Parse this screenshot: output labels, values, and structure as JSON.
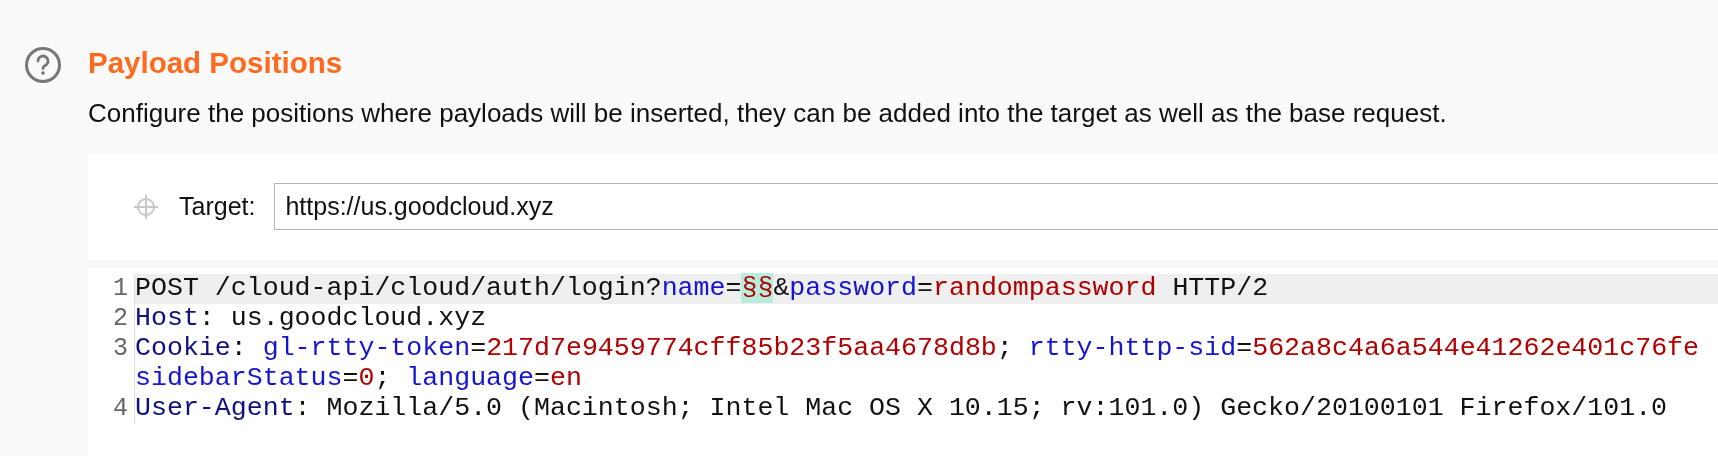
{
  "section": {
    "title": "Payload Positions",
    "description": "Configure the positions where payloads will be inserted, they can be added into the target as well as the base request."
  },
  "target": {
    "label": "Target:",
    "value": "https://us.goodcloud.xyz"
  },
  "request_lines": [
    {
      "number": "1",
      "highlighted": true,
      "tokens": [
        {
          "kind": "plain",
          "text": "POST /cloud-api/cloud/auth/login?"
        },
        {
          "kind": "param",
          "text": "name"
        },
        {
          "kind": "plain",
          "text": "="
        },
        {
          "kind": "marker",
          "text": "§§"
        },
        {
          "kind": "plain",
          "text": "&"
        },
        {
          "kind": "param",
          "text": "password"
        },
        {
          "kind": "plain",
          "text": "="
        },
        {
          "kind": "value",
          "text": "randompassword"
        },
        {
          "kind": "plain",
          "text": " HTTP/2"
        }
      ]
    },
    {
      "number": "2",
      "highlighted": false,
      "tokens": [
        {
          "kind": "header",
          "text": "Host"
        },
        {
          "kind": "plain",
          "text": ": us.goodcloud.xyz"
        }
      ]
    },
    {
      "number": "3",
      "highlighted": false,
      "tokens": [
        {
          "kind": "header",
          "text": "Cookie"
        },
        {
          "kind": "plain",
          "text": ": "
        },
        {
          "kind": "param",
          "text": "gl-rtty-token"
        },
        {
          "kind": "plain",
          "text": "="
        },
        {
          "kind": "value",
          "text": "217d7e9459774cff85b23f5aa4678d8b"
        },
        {
          "kind": "plain",
          "text": "; "
        },
        {
          "kind": "param",
          "text": "rtty-http-sid"
        },
        {
          "kind": "plain",
          "text": "="
        },
        {
          "kind": "value",
          "text": "562a8c4a6a544e41262e401c76fe"
        }
      ]
    },
    {
      "highlighted": false,
      "tokens": [
        {
          "kind": "param",
          "text": "sidebarStatus"
        },
        {
          "kind": "plain",
          "text": "="
        },
        {
          "kind": "value",
          "text": "0"
        },
        {
          "kind": "plain",
          "text": "; "
        },
        {
          "kind": "param",
          "text": "language"
        },
        {
          "kind": "plain",
          "text": "="
        },
        {
          "kind": "value",
          "text": "en"
        }
      ]
    },
    {
      "number": "4",
      "highlighted": false,
      "tokens": [
        {
          "kind": "header",
          "text": "User-Agent"
        },
        {
          "kind": "plain",
          "text": ": Mozilla/5.0 (Macintosh; Intel Mac OS X 10.15; rv:101.0) Gecko/20100101 Firefox/101.0"
        }
      ]
    }
  ]
}
